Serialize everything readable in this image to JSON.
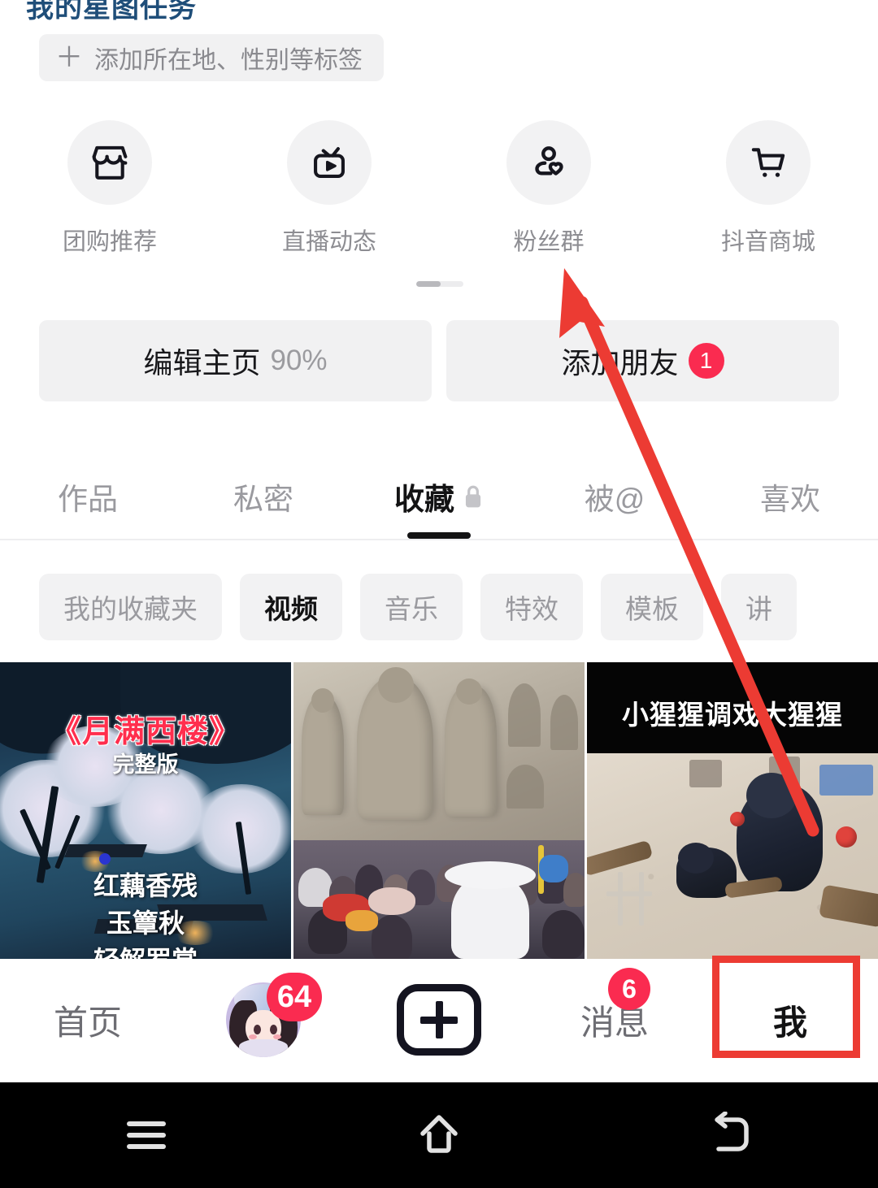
{
  "header": {
    "clipped_title": "我的星图任务",
    "tag_button": {
      "plus": "＋",
      "label": "添加所在地、性别等标签"
    }
  },
  "quick_actions": [
    {
      "label": "团购推荐",
      "icon": "store-icon"
    },
    {
      "label": "直播动态",
      "icon": "live-tv-icon"
    },
    {
      "label": "粉丝群",
      "icon": "fans-group-icon"
    },
    {
      "label": "抖音商城",
      "icon": "shopping-cart-icon"
    }
  ],
  "action_buttons": {
    "edit_profile": {
      "label": "编辑主页",
      "value": "90%"
    },
    "add_friend": {
      "label": "添加朋友",
      "badge": "1"
    }
  },
  "tabs": [
    {
      "label": "作品",
      "active": false,
      "lock": false
    },
    {
      "label": "私密",
      "active": false,
      "lock": false
    },
    {
      "label": "收藏",
      "active": true,
      "lock": true
    },
    {
      "label": "被@",
      "active": false,
      "lock": false
    },
    {
      "label": "喜欢",
      "active": false,
      "lock": false
    }
  ],
  "chips": [
    {
      "label": "我的收藏夹",
      "active": false
    },
    {
      "label": "视频",
      "active": true
    },
    {
      "label": "音乐",
      "active": false
    },
    {
      "label": "特效",
      "active": false
    },
    {
      "label": "模板",
      "active": false
    },
    {
      "label": "讲",
      "active": false
    }
  ],
  "thumbnails": [
    {
      "name": "moonlit-tower-video",
      "title": "《月满西楼》",
      "subtitle": "完整版",
      "lyric_line1": "红藕香残",
      "lyric_line2": "玉簟秋",
      "lyric_line3": "轻解罗裳"
    },
    {
      "name": "grotto-crowd-video",
      "caption": ""
    },
    {
      "name": "gorilla-video",
      "caption": "小猩猩调戏大猩猩"
    }
  ],
  "bottom_nav": [
    {
      "label": "首页",
      "active": false,
      "type": "text",
      "badge": ""
    },
    {
      "label": "",
      "active": false,
      "type": "avatar",
      "badge": "64"
    },
    {
      "label": "",
      "active": false,
      "type": "plus",
      "badge": ""
    },
    {
      "label": "消息",
      "active": false,
      "type": "text",
      "badge": "6"
    },
    {
      "label": "我",
      "active": true,
      "type": "text",
      "badge": ""
    }
  ],
  "system_nav": [
    {
      "icon": "menu-recents-icon"
    },
    {
      "icon": "home-icon"
    },
    {
      "icon": "back-icon"
    }
  ],
  "annotations": {
    "arrow_color": "#ec3b33",
    "highlight_color": "#ec3b33",
    "arrow_from_label": "我",
    "arrow_to_label": "粉丝群"
  },
  "colors": {
    "accent_red": "#fa2b50",
    "annotation_red": "#ec3b33",
    "chip_bg": "#f2f2f3",
    "text_primary": "#131314",
    "text_muted": "#9a9a9f",
    "title_blue": "#1f4e79"
  }
}
